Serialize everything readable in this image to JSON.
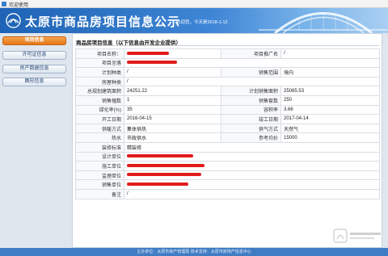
{
  "window": {
    "title": "欢迎使用"
  },
  "banner": {
    "title": "太原市商品房项目信息公示",
    "welcome": "欢迎您，今天是2018-1-12"
  },
  "sidebar": {
    "items": [
      {
        "label": "项目信息",
        "active": true
      },
      {
        "label": "许可证信息",
        "active": false
      },
      {
        "label": "房产数据信息",
        "active": false
      },
      {
        "label": "图形信息",
        "active": false
      }
    ]
  },
  "main": {
    "section_title": "商品房项目信息（以下信息由开发企业提供）",
    "rows": [
      {
        "l1": "项目名称：",
        "v1": "",
        "v1_redacted": true,
        "l2": "项目推广名",
        "v2": "/"
      },
      {
        "l1": "项目坐落",
        "v1": "",
        "v1_redacted": true
      },
      {
        "l1": "计划种类",
        "v1": "/",
        "l2": "销售范围",
        "v2": "境内"
      },
      {
        "l1": "房屋种类",
        "v1": "/"
      },
      {
        "l1": "总规划建筑面积",
        "v1": "24251.22",
        "l2": "计划销售面积",
        "v2": "25065.53"
      },
      {
        "l1": "销售幢数",
        "v1": "1",
        "l2": "销售套数",
        "v2": "250"
      },
      {
        "l1": "绿化率(%)",
        "v1": "35",
        "l2": "容积率",
        "v2": "3.66"
      },
      {
        "l1": "开工日期",
        "v1": "2016-04-15",
        "l2": "竣工日期",
        "v2": "2017-04-14"
      },
      {
        "l1": "供暖方式",
        "v1": "集体供热",
        "l2": "供气方式",
        "v2": "天然气"
      },
      {
        "l1": "热水",
        "v1": "市政供水",
        "l2": "参考均价",
        "v2": "15000"
      },
      {
        "l1": "装修标准",
        "v1": "精装修"
      },
      {
        "l1": "设计单位",
        "v1": "",
        "v1_redacted": true
      },
      {
        "l1": "施工单位",
        "v1": "",
        "v1_redacted": true
      },
      {
        "l1": "监理单位",
        "v1": "",
        "v1_redacted": true
      },
      {
        "l1": "销售单位",
        "v1": "",
        "v1_redacted": true
      },
      {
        "l1": "备注",
        "v1": "/"
      }
    ]
  },
  "footer": {
    "text": "主办单位：太原市房产管理局   技术支持：太原市房地产信息中心"
  },
  "colors": {
    "active_nav": "#e4761a",
    "banner": "#1e63b5",
    "redaction": "#e21a1a",
    "footer": "#3f7cc4"
  }
}
